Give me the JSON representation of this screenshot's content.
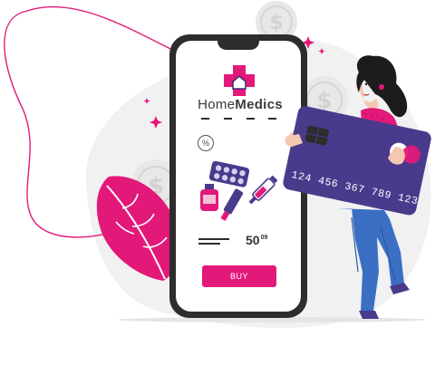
{
  "app": {
    "brand_part1": "Home",
    "brand_part2": "Medics"
  },
  "product": {
    "price_main": "50",
    "price_cents": "09",
    "discount_symbol": "%"
  },
  "actions": {
    "buy_label": "BUY"
  },
  "card": {
    "number": "124 456 367 789 123"
  },
  "colors": {
    "accent": "#e3197a",
    "card": "#4a3a8c",
    "phone_frame": "#2d2d2d",
    "jeans": "#3a6fc4",
    "background_blob": "#f1f1f1"
  },
  "icons": [
    "medical-cross-home-icon",
    "percent-icon",
    "dollar-coin-icon",
    "pill-blister-icon",
    "medicine-bottle-icon",
    "syringe-icon",
    "sparkle-icon",
    "leaf-icon"
  ]
}
